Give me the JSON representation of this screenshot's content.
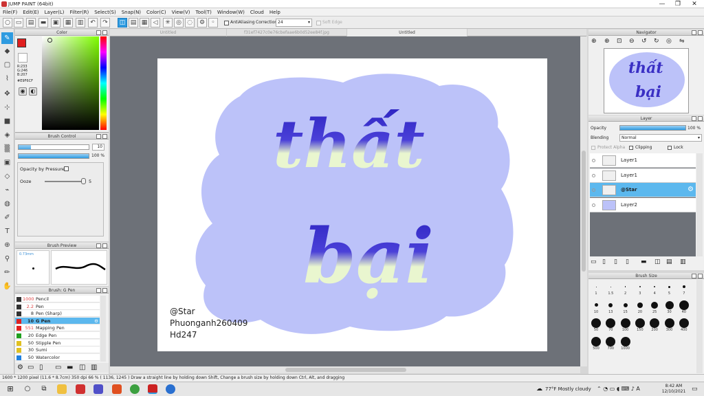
{
  "app": {
    "title": "JUMP PAINT (64bit)"
  },
  "window_controls": {
    "minimize": "—",
    "maximize": "❐",
    "close": "✕"
  },
  "menu": [
    "File(F)",
    "Edit(E)",
    "Layer(L)",
    "Filter(R)",
    "Select(S)",
    "Snap(N)",
    "Color(C)",
    "View(V)",
    "Tool(T)",
    "Window(W)",
    "Cloud",
    "Help"
  ],
  "toolbar": {
    "antialiasing_label": "AntiAliasing",
    "correction_label": "Correction",
    "correction_value": "24",
    "soft_edge_label": "Soft Edge"
  },
  "tabs": [
    "Untitled",
    "f31ef7427c0e76cbefaae6b0d52ee84f.jpg",
    "Untitled"
  ],
  "color_panel": {
    "title": "Color",
    "r": "R:233",
    "g": "G:246",
    "b": "B:207",
    "hex": "#E9F6CF"
  },
  "brush_control": {
    "title": "Brush Control",
    "size_value": "10",
    "opacity_value": "100 %",
    "opacity_pressure_label": "Opacity by Pressure",
    "ooze_label": "Ooze",
    "ooze_value": "5"
  },
  "brush_preview": {
    "title": "Brush Preview",
    "size": "0.73mm"
  },
  "brush_list": {
    "title": "Brush: G Pen",
    "items": [
      {
        "size": "1000",
        "name": "Pencil",
        "color": "#333333",
        "size_color": "#e04040"
      },
      {
        "size": "2.2",
        "name": "Pen",
        "color": "#333333",
        "size_color": "#e04040"
      },
      {
        "size": "8",
        "name": "Pen (Sharp)",
        "color": "#333333",
        "size_color": "#222222"
      },
      {
        "size": "10",
        "name": "G Pen",
        "color": "#e02020",
        "size_color": "#222222",
        "selected": true
      },
      {
        "size": "551",
        "name": "Mapping Pen",
        "color": "#e02020",
        "size_color": "#e04040"
      },
      {
        "size": "20",
        "name": "Edge Pen",
        "color": "#20a020",
        "size_color": "#222222"
      },
      {
        "size": "50",
        "name": "Stipple Pen",
        "color": "#e0c020",
        "size_color": "#222222"
      },
      {
        "size": "30",
        "name": "Sumi",
        "color": "#e0c020",
        "size_color": "#222222"
      },
      {
        "size": "50",
        "name": "Watercolor",
        "color": "#2080e0",
        "size_color": "#222222"
      }
    ]
  },
  "canvas": {
    "word1": "thất",
    "word2": "bại",
    "credit_lines": [
      "@Star",
      "Phuonganh260409",
      "Hd247"
    ]
  },
  "navigator": {
    "title": "Navigator"
  },
  "layer_panel": {
    "title": "Layer",
    "opacity_label": "Opacity",
    "opacity_value": "100 %",
    "blending_label": "Blending",
    "blending_value": "Normal",
    "protect_alpha_label": "Protect Alpha",
    "clipping_label": "Clipping",
    "lock_label": "Lock",
    "layers": [
      {
        "name": "Layer1",
        "selected": false
      },
      {
        "name": "Layer1",
        "selected": false
      },
      {
        "name": "@Star",
        "selected": true
      },
      {
        "name": "Layer2",
        "selected": false
      }
    ]
  },
  "brush_size": {
    "title": "Brush Size",
    "sizes": [
      "1",
      "1.5",
      "2",
      "3",
      "4",
      "5",
      "7",
      "10",
      "13",
      "15",
      "20",
      "25",
      "30",
      "40",
      "50",
      "70",
      "100",
      "150",
      "200",
      "300",
      "400",
      "500",
      "700",
      "1000"
    ]
  },
  "status": {
    "text": "1600 * 1200 pixel   (11.6 * 8.7cm)   350 dpi   66 %   ( 1136, 1245 )   Draw a straight line by holding down Shift, Change a brush size by holding down Ctrl, Alt, and dragging"
  },
  "taskbar": {
    "weather": "77°F  Mostly cloudy",
    "time": "8:42 AM",
    "date": "12/10/2021"
  },
  "colors": {
    "accent": "#2e9be0",
    "cloud": "#bcc2f9",
    "ink_blue": "#3a2fc4",
    "ink_light": "#e9f6cf"
  }
}
